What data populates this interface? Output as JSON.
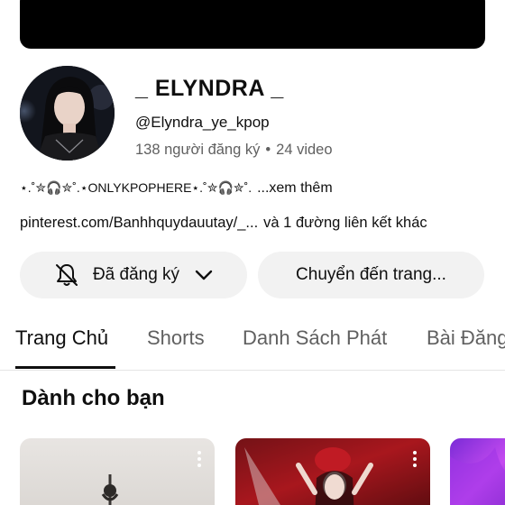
{
  "channel": {
    "name": "_ ELYNDRA _",
    "handle": "@Elyndra_ye_kpop",
    "subscribers": "138 người đăng ký",
    "separator": "•",
    "videos": "24 video"
  },
  "description": {
    "text": "⋆.˚✮🎧✮˚.⋆ONLYKPOPHERE⋆.˚✮🎧✮˚.",
    "more": "...xem thêm"
  },
  "links": {
    "url": "pinterest.com/Banhhquydauutay/_...",
    "extra": "và 1 đường liên kết khác"
  },
  "buttons": {
    "subscribed": "Đã đăng ký",
    "go_to_store": "Chuyển đến trang..."
  },
  "tabs": [
    {
      "label": "Trang Chủ",
      "active": true
    },
    {
      "label": "Shorts",
      "active": false
    },
    {
      "label": "Danh Sách Phát",
      "active": false
    },
    {
      "label": "Bài Đăng",
      "active": false
    }
  ],
  "section": {
    "title": "Dành cho bạn"
  },
  "icons": {
    "bell": "bell-icon",
    "chevron": "chevron-down-icon",
    "more": "more-vert-icon"
  },
  "colors": {
    "background": "#ffffff",
    "button_bg": "#f2f2f2",
    "secondary_text": "#606060",
    "banner": "#000000"
  }
}
